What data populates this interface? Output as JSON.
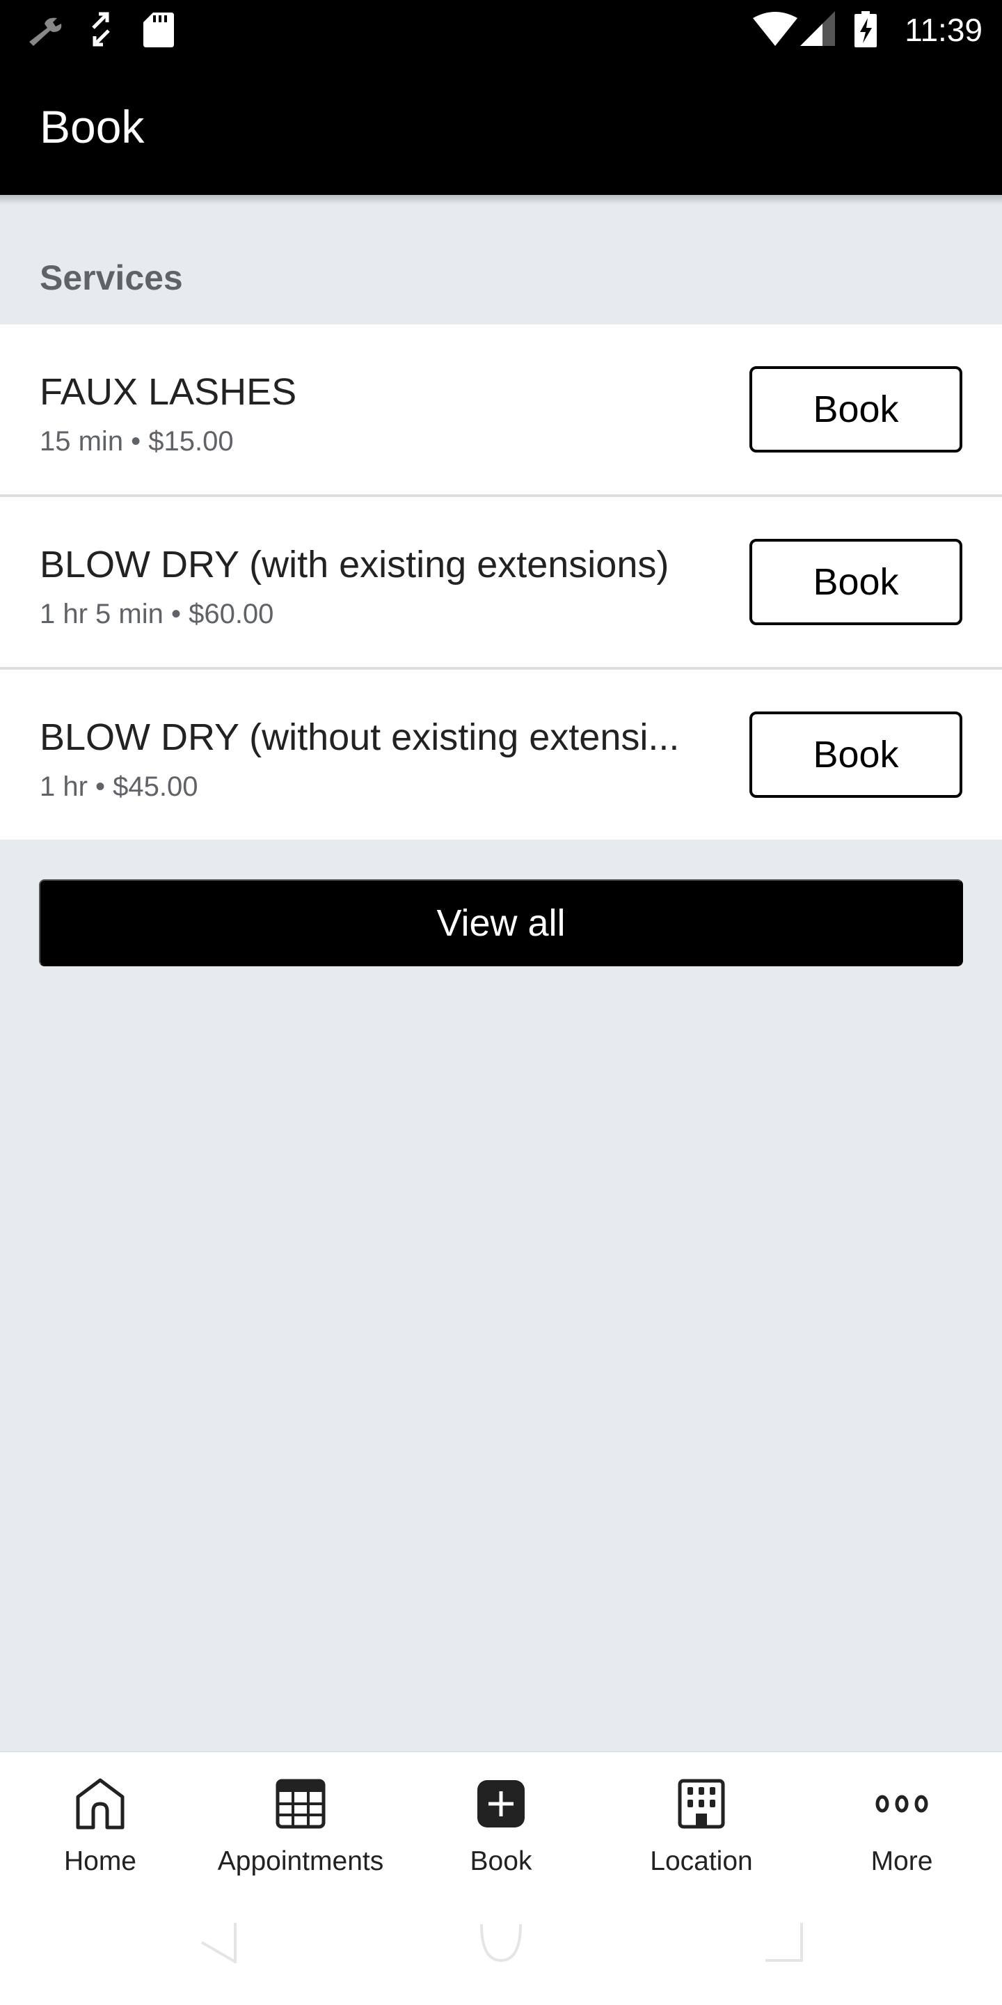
{
  "status_bar": {
    "time": "11:39",
    "left_icons": [
      "wrench-icon",
      "sync-arrows-icon",
      "sd-card-icon"
    ],
    "right_icons": [
      "wifi-icon",
      "cell-signal-icon",
      "battery-charging-icon"
    ]
  },
  "header": {
    "title": "Book"
  },
  "services": {
    "section_title": "Services",
    "items": [
      {
        "name": "FAUX LASHES",
        "meta": "15 min • $15.00",
        "button": "Book"
      },
      {
        "name": "BLOW DRY (with existing extensions)",
        "meta": "1 hr 5 min • $60.00",
        "button": "Book"
      },
      {
        "name": "BLOW DRY (without existing extensi...",
        "meta": "1 hr • $45.00",
        "button": "Book"
      }
    ],
    "view_all_label": "View all"
  },
  "bottom_nav": {
    "items": [
      {
        "label": "Home",
        "icon": "home-icon"
      },
      {
        "label": "Appointments",
        "icon": "calendar-grid-icon"
      },
      {
        "label": "Book",
        "icon": "plus-square-icon",
        "active": true
      },
      {
        "label": "Location",
        "icon": "building-icon"
      },
      {
        "label": "More",
        "icon": "more-dots-icon"
      }
    ]
  },
  "system_nav": [
    "back-button",
    "home-button",
    "recents-button"
  ],
  "colors": {
    "header_bg": "#000000",
    "page_bg": "#e8ebee",
    "primary_button": "#000000",
    "section_title": "#5f6368"
  }
}
